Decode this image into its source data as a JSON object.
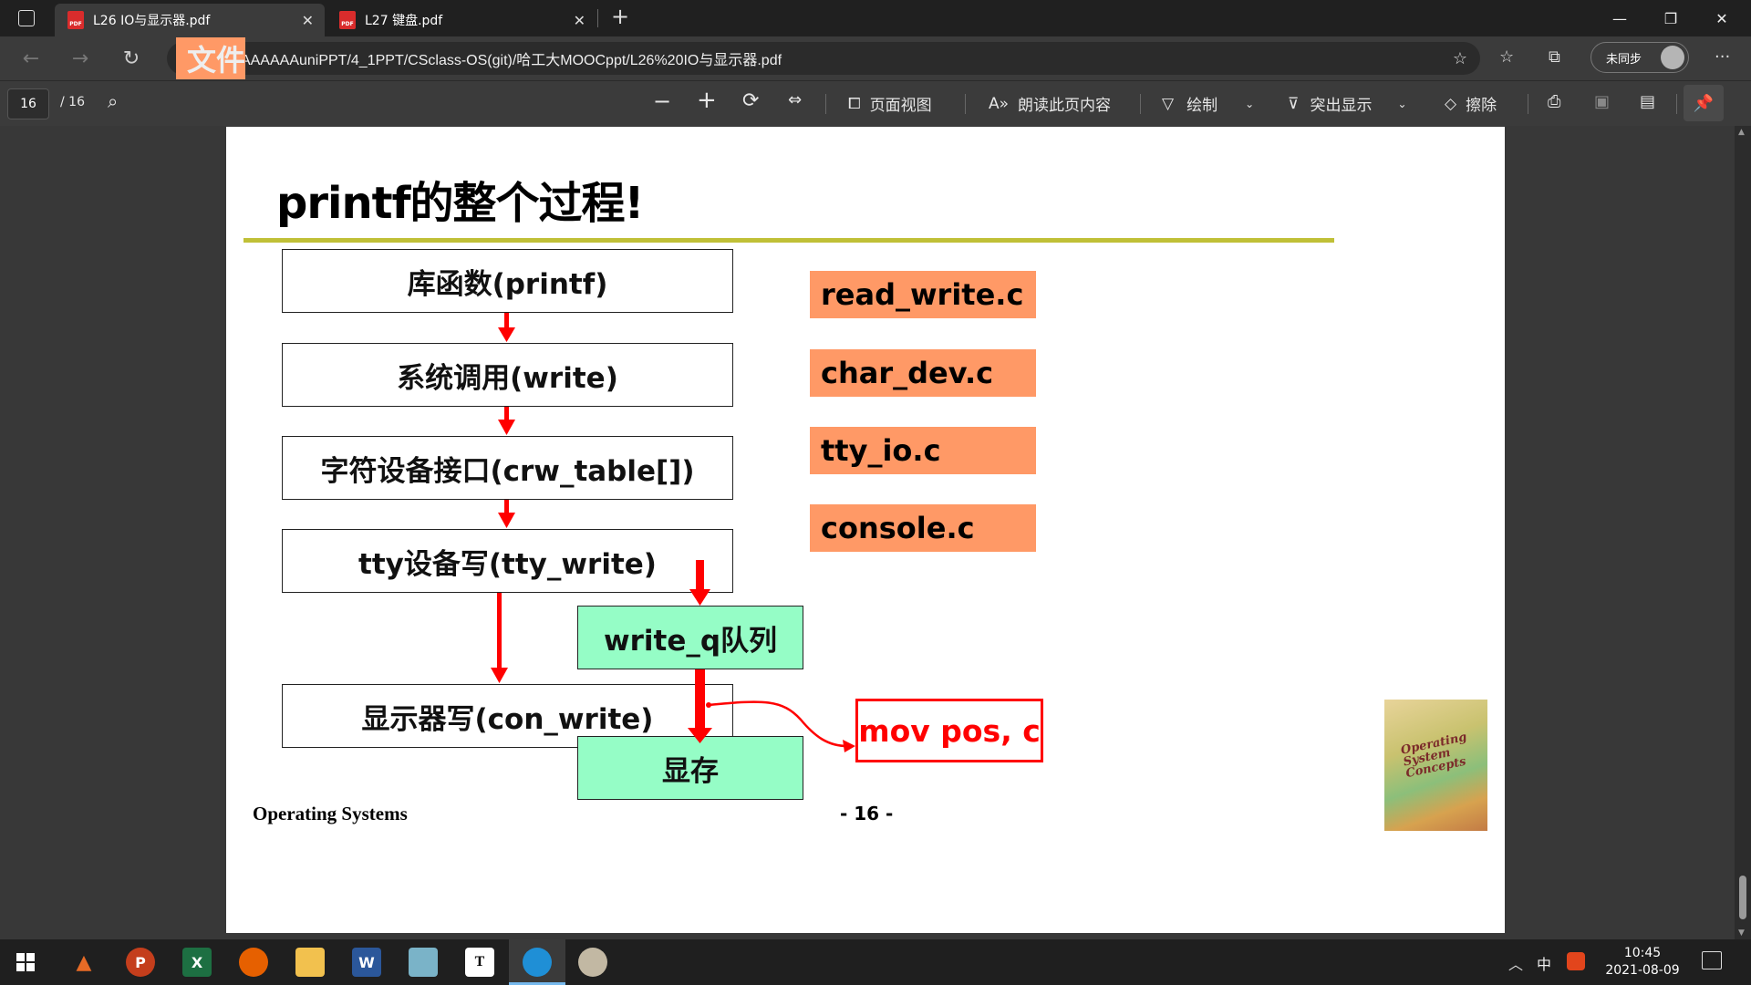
{
  "tabs": [
    {
      "label": "L26 IO与显示器.pdf",
      "active": true
    },
    {
      "label": "L27 键盘.pdf",
      "active": false
    }
  ],
  "address": {
    "scheme_label": "文件",
    "url": "E:/AAAAAAuniPPT/4_1PPT/CSclass-OS(git)/哈工大MOOCppt/L26%20IO与显示器.pdf",
    "sync_label": "未同步"
  },
  "pdf_toolbar": {
    "page_current": "16",
    "page_total": "/ 16",
    "page_view": "页面视图",
    "read_aloud": "朗读此页内容",
    "draw": "绘制",
    "highlight": "突出显示",
    "erase": "擦除"
  },
  "slide": {
    "title": "printf的整个过程!",
    "boxes": {
      "lib": "库函数(printf)",
      "syscall": "系统调用(write)",
      "chardev": "字符设备接口(crw_table[])",
      "tty": "tty设备写(tty_write)",
      "writeq": "write_q队列",
      "con": "显示器写(con_write)",
      "vram": "显存"
    },
    "files": [
      "read_write.c",
      "char_dev.c",
      "tty_io.c",
      "console.c"
    ],
    "mov": "mov pos, c",
    "footer_left": "Operating Systems",
    "footer_page": "- 16 -",
    "book_title": "Operating System Concepts"
  },
  "taskbar": {
    "time": "10:45",
    "date": "2021-08-09",
    "ime": "中"
  },
  "colors": {
    "file_box": "#ff9966",
    "green_box": "#95fdc6",
    "arrow": "#ff0000",
    "title_rule": "#c0c037"
  }
}
